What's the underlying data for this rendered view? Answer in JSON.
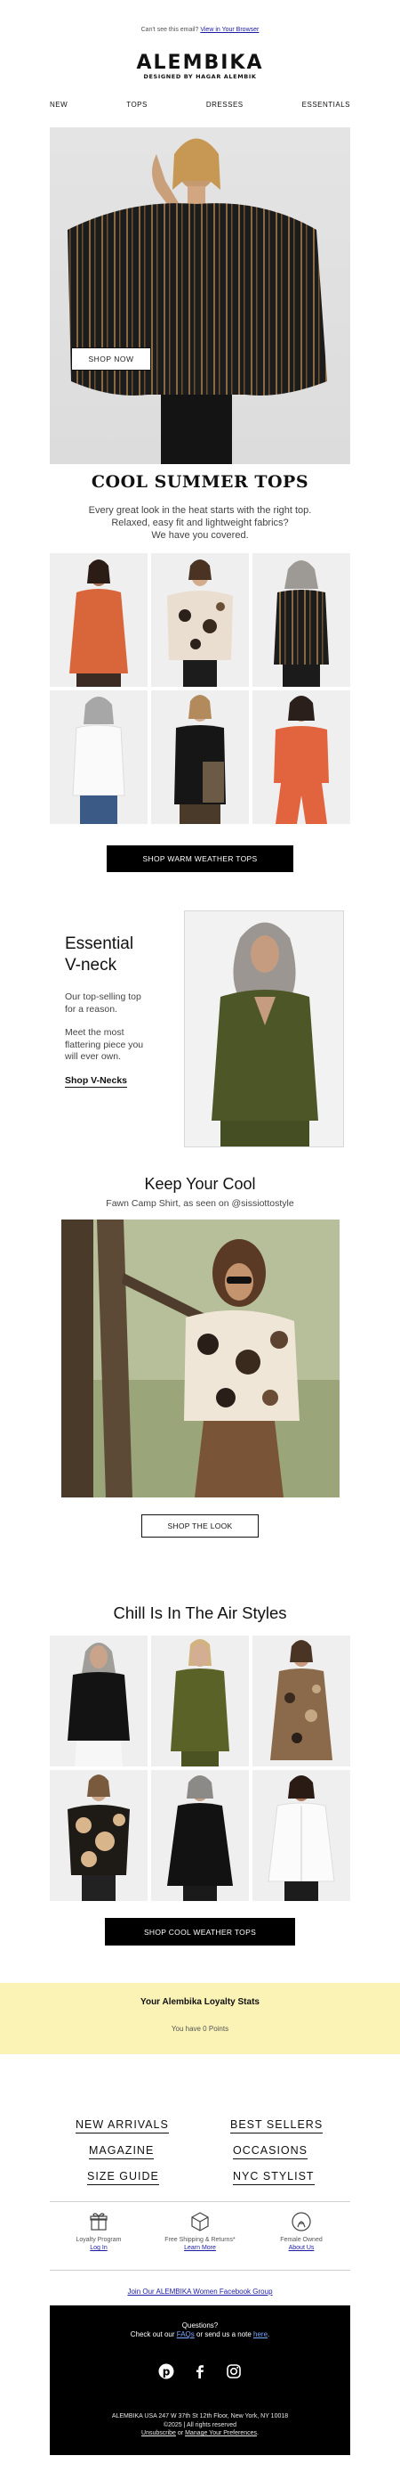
{
  "preheader": {
    "text": "Can't see this email? ",
    "link": "View in Your Browser"
  },
  "brand": {
    "name": "ALEMBIKA",
    "tagline": "DESIGNED BY HAGAR ALEMBIK"
  },
  "nav": [
    "NEW",
    "TOPS",
    "DRESSES",
    "ESSENTIALS"
  ],
  "hero": {
    "button": "SHOP NOW"
  },
  "summer": {
    "title": "COOL SUMMER TOPS",
    "lines": [
      "Every great look in the heat starts with the right top.",
      "Relaxed, easy fit and lightweight fabrics?",
      "We have you covered."
    ],
    "button": "SHOP WARM WEATHER TOPS"
  },
  "vneck": {
    "title_line1": "Essential",
    "title_line2": "V-neck",
    "para1_line1": "Our top-selling top",
    "para1_line2": "for a reason.",
    "para2_line1": "Meet the most",
    "para2_line2": "flattering piece you",
    "para2_line3": "will ever own.",
    "link": "Shop V-Necks"
  },
  "cool": {
    "title": "Keep Your Cool",
    "subtitle": "Fawn Camp Shirt, as seen on @sissiottostyle",
    "button": "SHOP THE LOOK"
  },
  "chill": {
    "title": "Chill Is In The Air Styles",
    "button": "SHOP COOL WEATHER TOPS"
  },
  "loyalty": {
    "title": "Your Alembika Loyalty Stats",
    "points": "You have 0 Points"
  },
  "footer_links": [
    [
      "NEW ARRIVALS",
      "BEST SELLERS"
    ],
    [
      "MAGAZINE",
      "OCCASIONS"
    ],
    [
      "SIZE GUIDE",
      "NYC STYLIST"
    ]
  ],
  "usps": [
    {
      "line1": "Loyalty Program",
      "link": "Log In",
      "icon": "gift-icon"
    },
    {
      "line1": "Free Shipping & Returns*",
      "link": "Learn More",
      "icon": "box-icon"
    },
    {
      "line1": "Female Owned",
      "link": "About Us",
      "icon": "female-owned-icon"
    }
  ],
  "facebook_link": "Join Our ALEMBIKA Women Facebook Group",
  "footer": {
    "question": "Questions?",
    "help_pre": "Check out our ",
    "faqs": "FAQs",
    "help_mid": " or send us a note ",
    "here": "here",
    "help_end": ".",
    "address": "ALEMBIKA USA 247 W 37th St 12th Floor, New York, NY 10018",
    "copyright": "©2025 | All rights reserved",
    "unsubscribe": "Unsubscribe",
    "or": " or ",
    "manage": "Manage Your Preferences",
    "period": "."
  },
  "colors": {
    "accent_black": "#000000",
    "loyalty_bg": "#fbf3b5",
    "link_blue": "#1a1aa6"
  }
}
